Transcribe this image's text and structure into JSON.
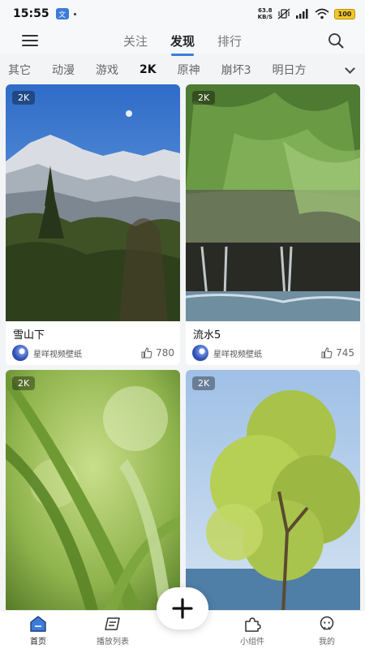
{
  "status_bar": {
    "time": "15:55",
    "app_badge": "文",
    "net_speed_value": "63.8",
    "net_speed_unit": "KB/S",
    "battery": "100"
  },
  "top_nav": {
    "tabs": [
      {
        "label": "关注",
        "active": false
      },
      {
        "label": "发现",
        "active": true
      },
      {
        "label": "排行",
        "active": false
      }
    ]
  },
  "categories": {
    "items": [
      "其它",
      "动漫",
      "游戏",
      "2K",
      "原神",
      "崩坏3",
      "明日方"
    ],
    "active": "2K"
  },
  "cards": [
    {
      "badge": "2K",
      "title": "雪山下",
      "author": "星咩视频壁纸",
      "likes": "780"
    },
    {
      "badge": "2K",
      "title": "流水5",
      "author": "星咩视频壁纸",
      "likes": "745"
    },
    {
      "badge": "2K"
    },
    {
      "badge": "2K"
    }
  ],
  "bottom_nav": {
    "items": [
      {
        "label": "首页",
        "icon": "home-icon",
        "active": true
      },
      {
        "label": "播放列表",
        "icon": "playlist-icon",
        "active": false
      },
      {
        "label": "小组件",
        "icon": "widget-icon",
        "active": false
      },
      {
        "label": "我的",
        "icon": "profile-icon",
        "active": false
      }
    ],
    "fab_icon": "plus-icon"
  },
  "colors": {
    "accent": "#3d7bd9",
    "background": "#f3f4f6",
    "card": "#ffffff"
  }
}
